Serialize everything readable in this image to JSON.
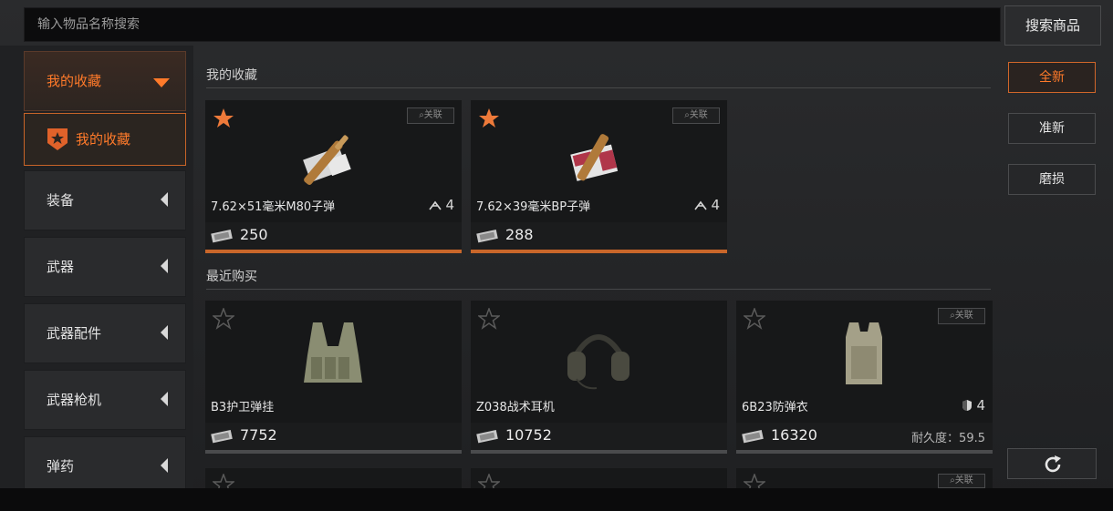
{
  "search": {
    "placeholder": "输入物品名称搜索",
    "button_label": "搜索商品"
  },
  "sidebar": {
    "header_label": "我的收藏",
    "favorite_label": "我的收藏",
    "categories": [
      {
        "label": "装备"
      },
      {
        "label": "武器"
      },
      {
        "label": "武器配件"
      },
      {
        "label": "武器枪机"
      },
      {
        "label": "弹药"
      }
    ]
  },
  "sections": {
    "favorites_title": "我的收藏",
    "recent_title": "最近购买"
  },
  "related_label": "关联",
  "favorites": [
    {
      "name": "7.62×51毫米M80子弹",
      "stat": "4",
      "price": "250",
      "starred": true
    },
    {
      "name": "7.62×39毫米BP子弹",
      "stat": "4",
      "price": "288",
      "starred": true
    }
  ],
  "recent": [
    {
      "name": "B3护卫弹挂",
      "price": "7752"
    },
    {
      "name": "Z038战术耳机",
      "price": "10752"
    },
    {
      "name": "6B23防弹衣",
      "stat": "4",
      "price": "16320",
      "durability": "耐久度：59.5"
    }
  ],
  "filters": [
    {
      "label": "全新",
      "active": true
    },
    {
      "label": "准新",
      "active": false
    },
    {
      "label": "磨损",
      "active": false
    }
  ],
  "colors": {
    "accent": "#ff7a2a",
    "accent_border": "#c8662a",
    "background": "#131415"
  }
}
